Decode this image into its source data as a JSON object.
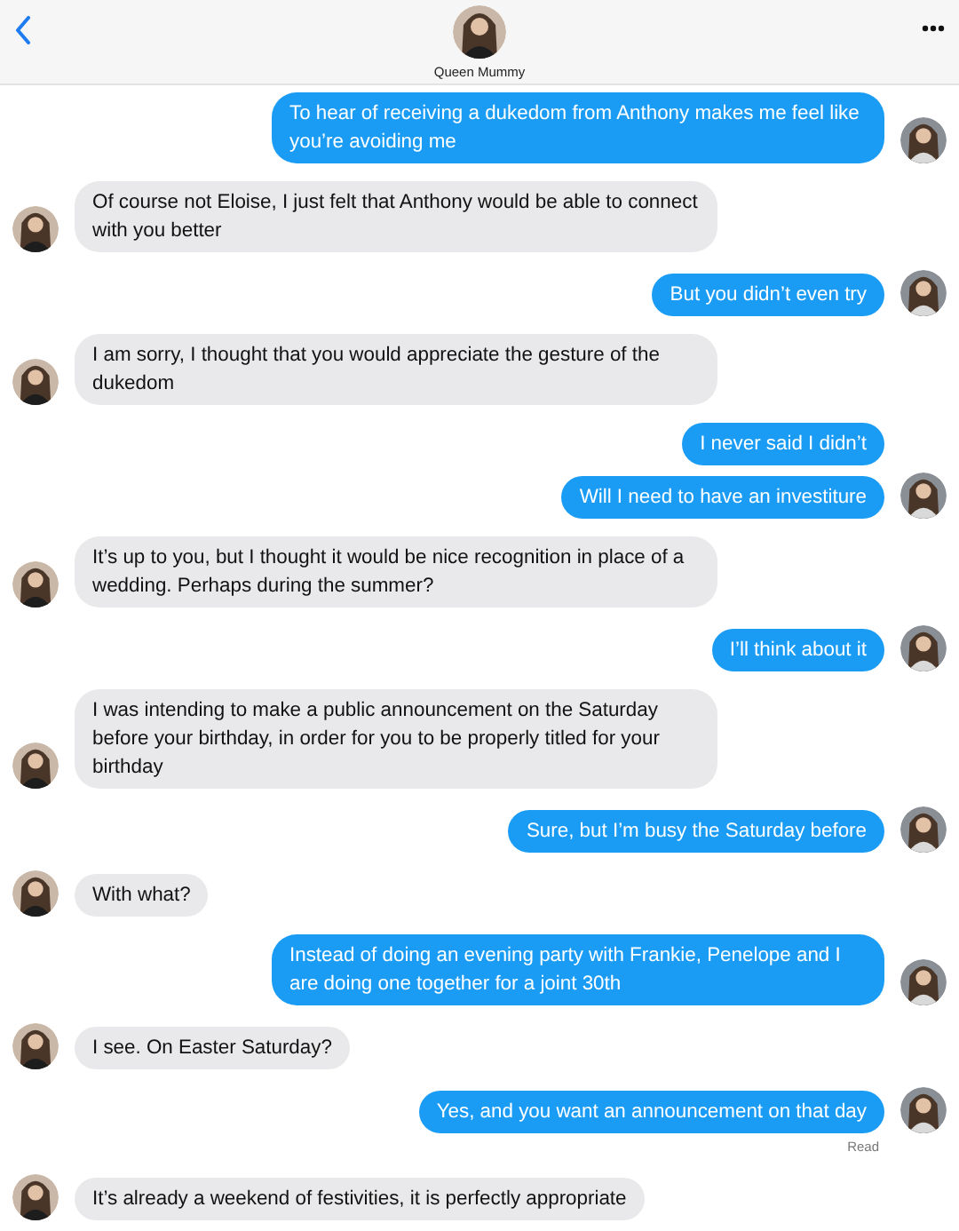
{
  "header": {
    "contact_name": "Queen Mummy"
  },
  "messages": [
    {
      "kind": "sent",
      "text": "To hear of receiving a dukedom from Anthony makes me feel like you’re avoiding me",
      "avatar": true
    },
    {
      "kind": "received",
      "text": "Of course not Eloise, I just felt that Anthony would be able to connect with you better",
      "avatar": true
    },
    {
      "kind": "sent",
      "text": "But you didn’t even try",
      "avatar": true
    },
    {
      "kind": "received",
      "text": "I am sorry, I thought that you would appreciate the gesture of the dukedom",
      "avatar": true
    },
    {
      "kind": "sent",
      "text": "I never said I didn’t",
      "avatar": false
    },
    {
      "kind": "sent",
      "text": "Will I need to have an investiture",
      "avatar": true
    },
    {
      "kind": "received",
      "text": "It’s up to you, but I thought it would be nice recognition in place of a wedding. Perhaps during the summer?",
      "avatar": true
    },
    {
      "kind": "sent",
      "text": "I’ll think about it",
      "avatar": true
    },
    {
      "kind": "received",
      "text": "I was intending to make a public announcement on the Saturday before your birthday, in order for you to be properly titled for your birthday",
      "avatar": true
    },
    {
      "kind": "sent",
      "text": "Sure, but I’m busy the Saturday before",
      "avatar": true
    },
    {
      "kind": "received",
      "text": "With what?",
      "avatar": true
    },
    {
      "kind": "sent",
      "text": "Instead of doing an evening party with Frankie, Penelope and I are doing one together for a joint 30th",
      "avatar": true
    },
    {
      "kind": "received",
      "text": "I see. On Easter Saturday?",
      "avatar": true
    },
    {
      "kind": "sent",
      "text": "Yes, and you want an announcement on that day",
      "avatar": true,
      "status": "Read"
    },
    {
      "kind": "received",
      "text": "It’s already a weekend of festivities, it is perfectly appropriate",
      "avatar": true
    }
  ]
}
